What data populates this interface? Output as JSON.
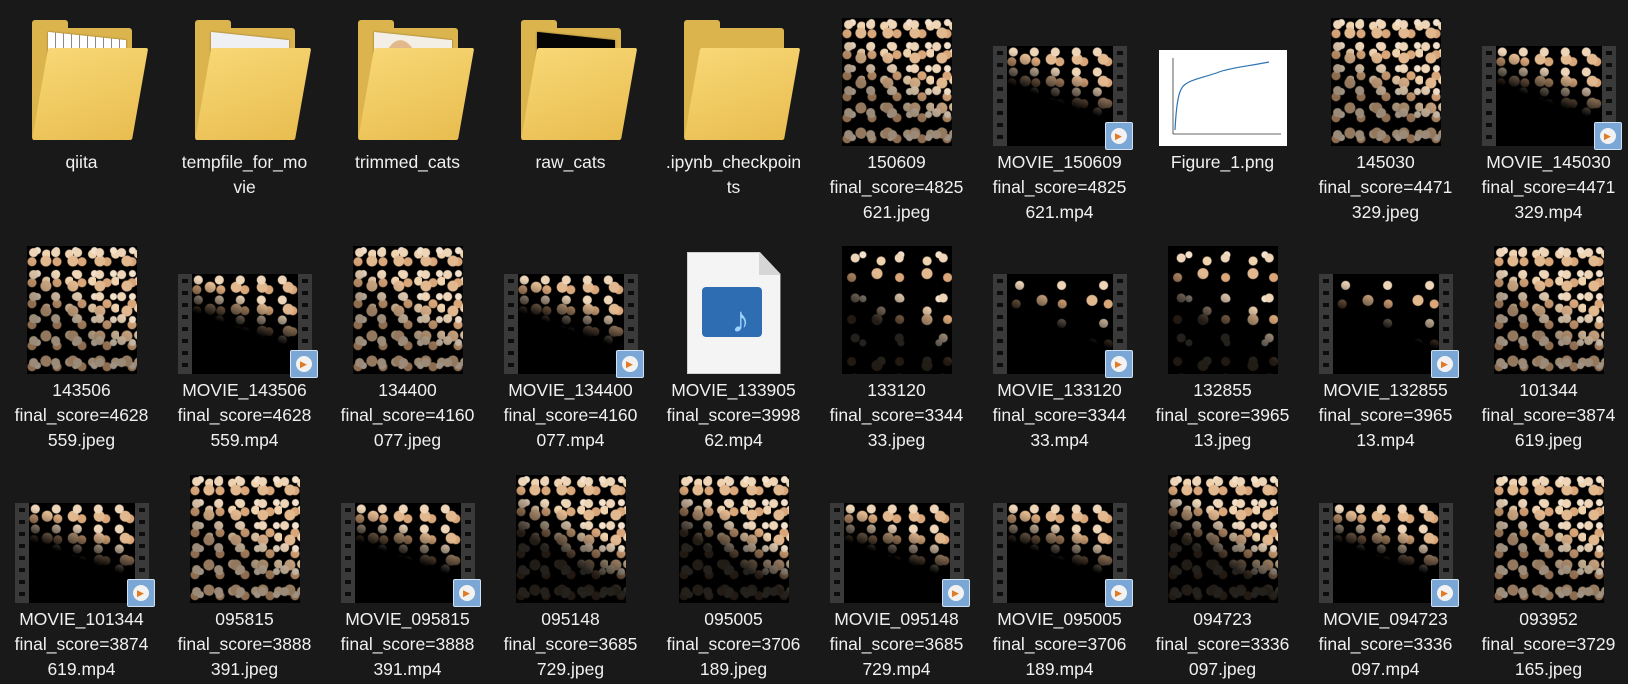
{
  "items": [
    {
      "kind": "folder",
      "variant": "chart",
      "label": [
        "qiita"
      ]
    },
    {
      "kind": "folder",
      "variant": "pyfile",
      "label": [
        "tempfile_for_mo",
        "vie"
      ]
    },
    {
      "kind": "folder",
      "variant": "cat",
      "label": [
        "trimmed_cats"
      ]
    },
    {
      "kind": "folder",
      "variant": "black",
      "label": [
        "raw_cats"
      ]
    },
    {
      "kind": "folder",
      "variant": "empty",
      "label": [
        ".ipynb_checkpoin",
        "ts"
      ]
    },
    {
      "kind": "image",
      "variant": "full",
      "label": [
        "150609",
        "final_score=4825",
        "621.jpeg"
      ]
    },
    {
      "kind": "video",
      "variant": "dense",
      "label": [
        "MOVIE_150609",
        "final_score=4825",
        "621.mp4"
      ]
    },
    {
      "kind": "figure",
      "label": [
        "Figure_1.png"
      ]
    },
    {
      "kind": "image",
      "variant": "full",
      "label": [
        "145030",
        "final_score=4471",
        "329.jpeg"
      ]
    },
    {
      "kind": "video",
      "variant": "dense",
      "label": [
        "MOVIE_145030",
        "final_score=4471",
        "329.mp4"
      ]
    },
    {
      "kind": "image",
      "variant": "full",
      "label": [
        "143506",
        "final_score=4628",
        "559.jpeg"
      ]
    },
    {
      "kind": "video",
      "variant": "dense",
      "label": [
        "MOVIE_143506",
        "final_score=4628",
        "559.mp4"
      ]
    },
    {
      "kind": "image",
      "variant": "full",
      "label": [
        "134400",
        "final_score=4160",
        "077.jpeg"
      ]
    },
    {
      "kind": "video",
      "variant": "dense",
      "label": [
        "MOVIE_134400",
        "final_score=4160",
        "077.mp4"
      ]
    },
    {
      "kind": "media",
      "label": [
        "MOVIE_133905",
        "final_score=3998",
        "62.mp4"
      ]
    },
    {
      "kind": "image",
      "variant": "sparse",
      "label": [
        "133120",
        "final_score=3344",
        "33.jpeg"
      ]
    },
    {
      "kind": "video",
      "variant": "sparse",
      "label": [
        "MOVIE_133120",
        "final_score=3344",
        "33.mp4"
      ]
    },
    {
      "kind": "image",
      "variant": "sparse",
      "label": [
        "132855",
        "final_score=3965",
        "13.jpeg"
      ]
    },
    {
      "kind": "video",
      "variant": "sparse",
      "label": [
        "MOVIE_132855",
        "final_score=3965",
        "13.mp4"
      ]
    },
    {
      "kind": "image",
      "variant": "full",
      "label": [
        "101344",
        "final_score=3874",
        "619.jpeg"
      ]
    },
    {
      "kind": "video",
      "variant": "dense",
      "label": [
        "MOVIE_101344",
        "final_score=3874",
        "619.mp4"
      ]
    },
    {
      "kind": "image",
      "variant": "full",
      "label": [
        "095815",
        "final_score=3888",
        "391.jpeg"
      ]
    },
    {
      "kind": "video",
      "variant": "dense",
      "label": [
        "MOVIE_095815",
        "final_score=3888",
        "391.mp4"
      ]
    },
    {
      "kind": "image",
      "variant": "partial",
      "label": [
        "095148",
        "final_score=3685",
        "729.jpeg"
      ]
    },
    {
      "kind": "image",
      "variant": "partial",
      "label": [
        "095005",
        "final_score=3706",
        "189.jpeg"
      ]
    },
    {
      "kind": "video",
      "variant": "dense",
      "label": [
        "MOVIE_095148",
        "final_score=3685",
        "729.mp4"
      ]
    },
    {
      "kind": "video",
      "variant": "dense",
      "label": [
        "MOVIE_095005",
        "final_score=3706",
        "189.mp4"
      ]
    },
    {
      "kind": "image",
      "variant": "partial",
      "label": [
        "094723",
        "final_score=3336",
        "097.jpeg"
      ]
    },
    {
      "kind": "video",
      "variant": "dense",
      "label": [
        "MOVIE_094723",
        "final_score=3336",
        "097.mp4"
      ]
    },
    {
      "kind": "image",
      "variant": "full",
      "label": [
        "093952",
        "final_score=3729",
        "165.jpeg"
      ]
    }
  ]
}
